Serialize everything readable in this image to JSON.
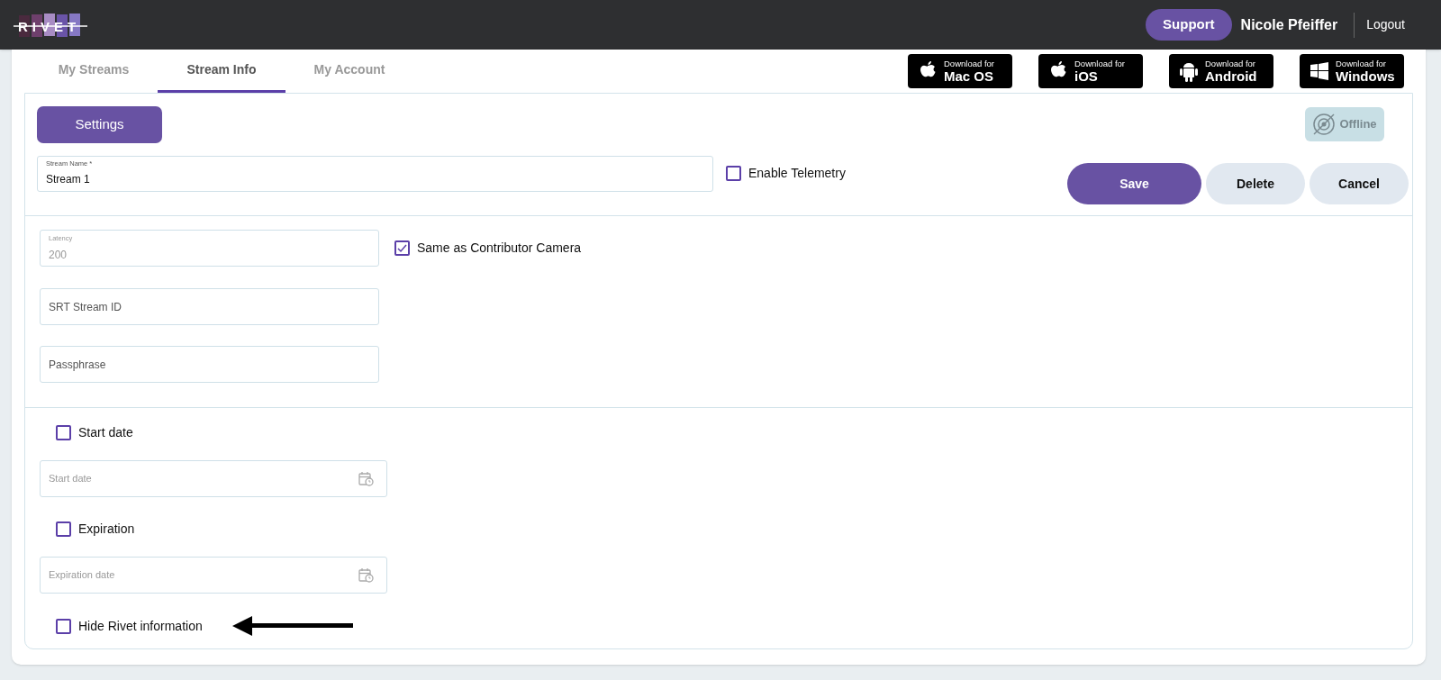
{
  "header": {
    "logo": "RIVET",
    "support_button": "Support",
    "user_name": "Nicole Pfeiffer",
    "logout": "Logout"
  },
  "tabs": [
    {
      "label": "My Streams",
      "selected": false
    },
    {
      "label": "Stream Info",
      "selected": true
    },
    {
      "label": "My Account",
      "selected": false
    }
  ],
  "downloads": [
    {
      "kind": "apple",
      "line_1": "Download for",
      "line_2": "Mac OS"
    },
    {
      "kind": "apple",
      "line_1": "Download for",
      "line_2": "iOS"
    },
    {
      "kind": "android",
      "line_1": "Download for",
      "line_2": "Android"
    },
    {
      "kind": "windows",
      "line_1": "Download for",
      "line_2": "Windows"
    }
  ],
  "settings_button": "Settings",
  "status_badge": "Offline",
  "stream_name": {
    "label": "Stream Name *",
    "value": "Stream 1"
  },
  "enable_telemetry": {
    "label": "Enable Telemetry",
    "checked": false
  },
  "actions": [
    {
      "kind": "primary",
      "label": "Save"
    },
    {
      "kind": "secondary",
      "label": "Delete"
    },
    {
      "kind": "secondary",
      "label": "Cancel"
    }
  ],
  "latency": {
    "label": "Latency",
    "value": "200",
    "disabled": true
  },
  "same_as_camera": {
    "label": "Same as Contributor Camera",
    "checked": true
  },
  "srt_fields": [
    {
      "placeholder": "SRT Stream ID"
    },
    {
      "placeholder": "Passphrase"
    }
  ],
  "date_options": [
    {
      "label": "Start date",
      "checked": false,
      "placeholder": "Start date"
    },
    {
      "label": "Expiration",
      "checked": false,
      "placeholder": "Expiration date"
    }
  ],
  "hide_info": {
    "label": "Hide Rivet information",
    "checked": false
  }
}
